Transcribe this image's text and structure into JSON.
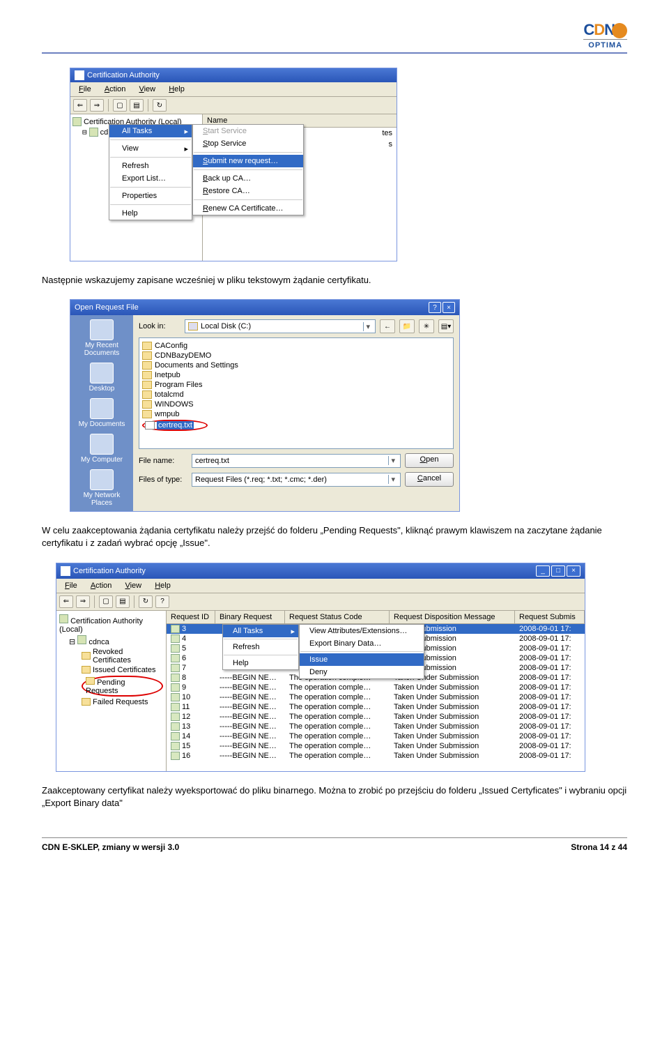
{
  "logo": {
    "c": "C",
    "d": "D",
    "n": "N",
    "sub": "OPTIMA"
  },
  "para1": "Następnie wskazujemy zapisane wcześniej w pliku tekstowym żądanie certyfikatu.",
  "para2": "W celu zaakceptowania żądania certyfikatu należy przejść do folderu „Pending Requests\", kliknąć prawym klawiszem na zaczytane żądanie certyfikatu i z zadań wybrać opcję „Issue\".",
  "para3": "Zaakceptowany certyfikat należy wyeksportować do pliku binarnego. Można to zrobić po przejściu do folderu „Issued Certyficates\" i wybraniu opcji „Export Binary data\"",
  "mmc1": {
    "title": "Certification Authority",
    "menus": [
      "File",
      "Action",
      "View",
      "Help"
    ],
    "tree_root": "Certification Authority (Local)",
    "tree_child_prefix": "cd",
    "list_head": "Name",
    "list_suffix1": "tes",
    "list_suffix2": "s",
    "ctx1": {
      "all_tasks": "All Tasks",
      "view": "View",
      "refresh": "Refresh",
      "export_list": "Export List…",
      "properties": "Properties",
      "help": "Help"
    },
    "ctx2": {
      "start": "Start Service",
      "stop": "Stop Service",
      "submit": "Submit new request…",
      "backup": "Back up CA…",
      "restore": "Restore CA…",
      "renew": "Renew CA Certificate…"
    }
  },
  "dlg": {
    "title": "Open Request File",
    "look_label": "Look in:",
    "look_value": "Local Disk (C:)",
    "places": [
      "My Recent Documents",
      "Desktop",
      "My Documents",
      "My Computer",
      "My Network Places"
    ],
    "folders": [
      "CAConfig",
      "CDNBazyDEMO",
      "Documents and Settings",
      "Inetpub",
      "Program Files",
      "totalcmd",
      "WINDOWS",
      "wmpub"
    ],
    "file": "certreq.txt",
    "fname_label": "File name:",
    "fname_value": "certreq.txt",
    "ftype_label": "Files of type:",
    "ftype_value": "Request Files (*.req; *.txt; *.cmc; *.der)",
    "open": "Open",
    "cancel": "Cancel"
  },
  "mmc2": {
    "title": "Certification Authority",
    "menus": [
      "File",
      "Action",
      "View",
      "Help"
    ],
    "root": "Certification Authority (Local)",
    "ca": "cdnca",
    "folders": [
      "Revoked Certificates",
      "Issued Certificates",
      "Pending Requests",
      "Failed Requests"
    ],
    "heads": [
      "Request ID",
      "Binary Request",
      "Request Status Code",
      "Request Disposition Message",
      "Request Submis"
    ],
    "ctx3": {
      "all_tasks": "All Tasks",
      "refresh": "Refresh",
      "help": "Help"
    },
    "ctx4": {
      "view": "View Attributes/Extensions…",
      "export": "Export Binary Data…",
      "issue": "Issue",
      "deny": "Deny"
    },
    "rows": [
      {
        "id": "3",
        "br": "",
        "sc": "",
        "dm": "Under Submission",
        "dt": "2008-09-01 17:"
      },
      {
        "id": "4",
        "br": "",
        "sc": "",
        "dm": "Under Submission",
        "dt": "2008-09-01 17:"
      },
      {
        "id": "5",
        "br": "",
        "sc": "",
        "dm": "Under Submission",
        "dt": "2008-09-01 17:"
      },
      {
        "id": "6",
        "br": "",
        "sc": "",
        "dm": "Under Submission",
        "dt": "2008-09-01 17:"
      },
      {
        "id": "7",
        "br": "",
        "sc": "",
        "dm": "Under Submission",
        "dt": "2008-09-01 17:"
      },
      {
        "id": "8",
        "br": "-----BEGIN NE…",
        "sc": "The operation comple…",
        "dm": "Taken Under Submission",
        "dt": "2008-09-01 17:"
      },
      {
        "id": "9",
        "br": "-----BEGIN NE…",
        "sc": "The operation comple…",
        "dm": "Taken Under Submission",
        "dt": "2008-09-01 17:"
      },
      {
        "id": "10",
        "br": "-----BEGIN NE…",
        "sc": "The operation comple…",
        "dm": "Taken Under Submission",
        "dt": "2008-09-01 17:"
      },
      {
        "id": "11",
        "br": "-----BEGIN NE…",
        "sc": "The operation comple…",
        "dm": "Taken Under Submission",
        "dt": "2008-09-01 17:"
      },
      {
        "id": "12",
        "br": "-----BEGIN NE…",
        "sc": "The operation comple…",
        "dm": "Taken Under Submission",
        "dt": "2008-09-01 17:"
      },
      {
        "id": "13",
        "br": "-----BEGIN NE…",
        "sc": "The operation comple…",
        "dm": "Taken Under Submission",
        "dt": "2008-09-01 17:"
      },
      {
        "id": "14",
        "br": "-----BEGIN NE…",
        "sc": "The operation comple…",
        "dm": "Taken Under Submission",
        "dt": "2008-09-01 17:"
      },
      {
        "id": "15",
        "br": "-----BEGIN NE…",
        "sc": "The operation comple…",
        "dm": "Taken Under Submission",
        "dt": "2008-09-01 17:"
      },
      {
        "id": "16",
        "br": "-----BEGIN NE…",
        "sc": "The operation comple…",
        "dm": "Taken Under Submission",
        "dt": "2008-09-01 17:"
      }
    ]
  },
  "footer": {
    "left": "CDN E-SKLEP, zmiany w wersji 3.0",
    "right": "Strona 14 z 44"
  }
}
